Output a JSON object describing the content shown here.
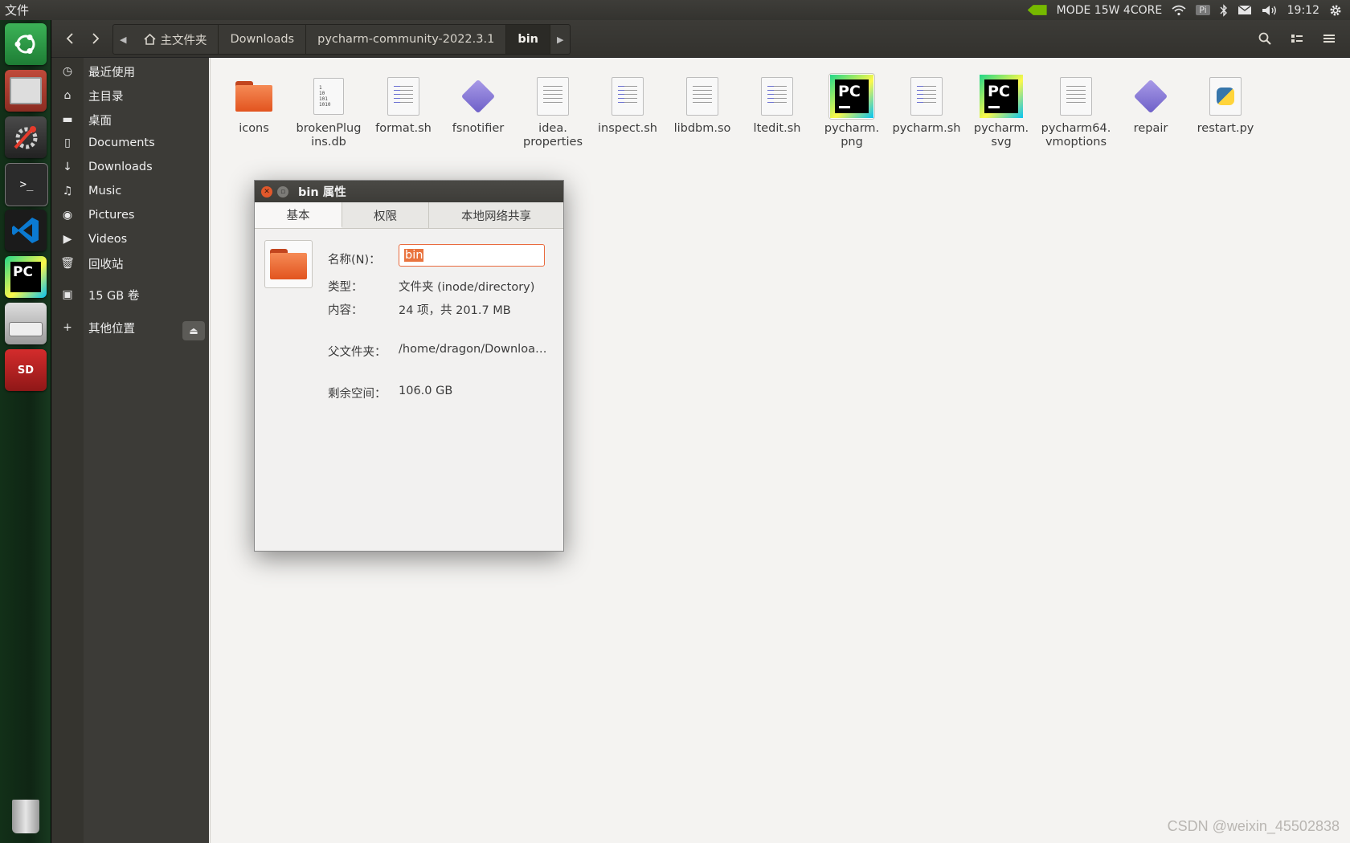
{
  "top_panel": {
    "app_menu": "文件",
    "mode": "MODE 15W 4CORE",
    "pi": "Pi",
    "time": "19:12"
  },
  "nav": {
    "breadcrumbs": [
      "主文件夹",
      "Downloads",
      "pycharm-community-2022.3.1",
      "bin"
    ]
  },
  "sidebar": {
    "items": [
      {
        "icon": "clock-icon",
        "label": "最近使用"
      },
      {
        "icon": "home-icon",
        "label": "主目录"
      },
      {
        "icon": "folder-icon",
        "label": "桌面"
      },
      {
        "icon": "document-icon",
        "label": "Documents"
      },
      {
        "icon": "download-icon",
        "label": "Downloads"
      },
      {
        "icon": "music-icon",
        "label": "Music"
      },
      {
        "icon": "camera-icon",
        "label": "Pictures"
      },
      {
        "icon": "video-icon",
        "label": "Videos"
      },
      {
        "icon": "trash-icon",
        "label": "回收站"
      },
      {
        "icon": "drive-icon",
        "label": "15 GB 卷"
      },
      {
        "icon": "plus-icon",
        "label": "其他位置"
      }
    ]
  },
  "files": [
    {
      "name": "icons",
      "type": "folder"
    },
    {
      "name": "brokenPlugins.db",
      "type": "binary"
    },
    {
      "name": "format.sh",
      "type": "script"
    },
    {
      "name": "fsnotifier",
      "type": "executable"
    },
    {
      "name": "idea.properties",
      "type": "text"
    },
    {
      "name": "inspect.sh",
      "type": "script"
    },
    {
      "name": "libdbm.so",
      "type": "text"
    },
    {
      "name": "ltedit.sh",
      "type": "script"
    },
    {
      "name": "pycharm.png",
      "type": "pycharm"
    },
    {
      "name": "pycharm.sh",
      "type": "script"
    },
    {
      "name": "pycharm.svg",
      "type": "pycharm"
    },
    {
      "name": "pycharm64.vmoptions",
      "type": "text"
    },
    {
      "name": "repair",
      "type": "executable"
    },
    {
      "name": "restart.py",
      "type": "python"
    }
  ],
  "file_labels": {
    "f0": "icons",
    "f1": "brokenPlug\nins.db",
    "f2": "format.sh",
    "f3": "fsnotifier",
    "f4": "idea.\nproperties",
    "f5": "inspect.sh",
    "f6": "libdbm.so",
    "f7": "ltedit.sh",
    "f8": "pycharm.\npng",
    "f9": "pycharm.sh",
    "f10": "pycharm.\nsvg",
    "f11": "pycharm64.\nvmoptions",
    "f12": "repair",
    "f13": "restart.py"
  },
  "dialog": {
    "title": "bin 属性",
    "tabs": [
      "基本",
      "权限",
      "本地网络共享"
    ],
    "name_label": "名称(N)：",
    "name_value": "bin",
    "type_label": "类型：",
    "type_value": "文件夹 (inode/directory)",
    "contents_label": "内容：",
    "contents_value": "24 项，共 201.7 MB",
    "parent_label": "父文件夹：",
    "parent_value": "/home/dragon/Download…",
    "free_label": "剩余空间：",
    "free_value": "106.0 GB"
  },
  "watermark": "CSDN @weixin_45502838",
  "colors": {
    "accent": "#e9743f",
    "folder": "#e2541f",
    "launcher_bg": "#123018"
  }
}
